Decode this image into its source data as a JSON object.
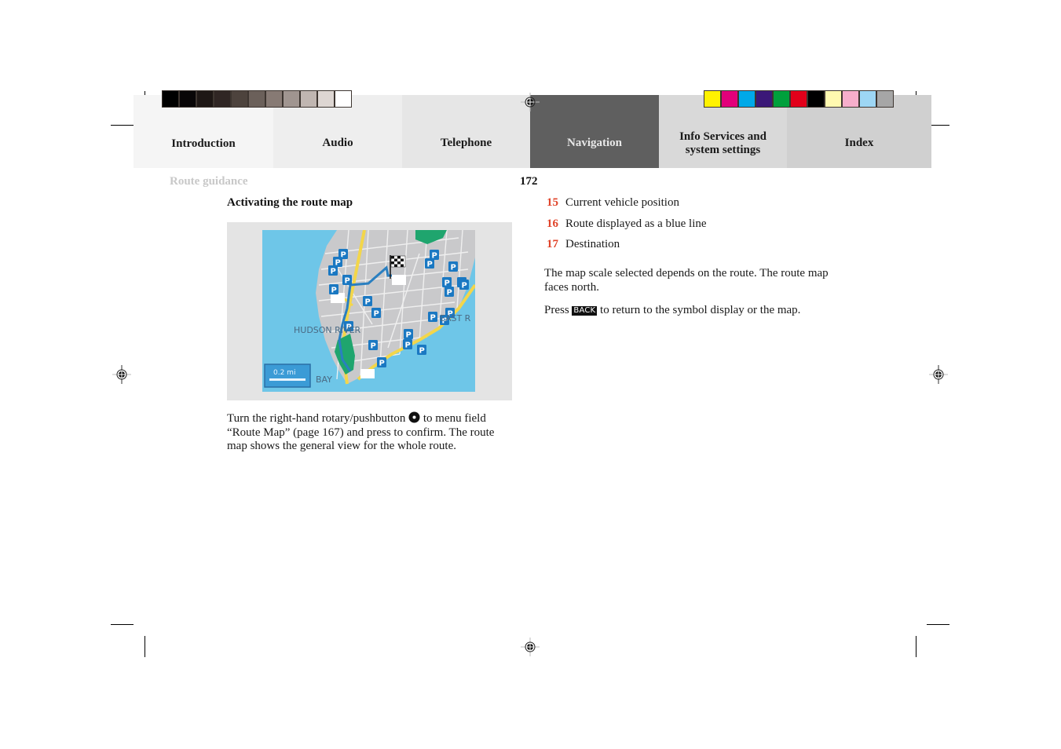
{
  "tabs": [
    {
      "label": "Introduction",
      "active": false,
      "bg": "#f5f5f5"
    },
    {
      "label": "Audio",
      "active": false,
      "bg": "#eeeeee"
    },
    {
      "label": "Telephone",
      "active": false,
      "bg": "#e6e6e6"
    },
    {
      "label": "Navigation",
      "active": true,
      "bg": "#5f5f5f"
    },
    {
      "label": "Info Services and system settings",
      "line1": "Info Services and",
      "line2": "system settings",
      "active": false,
      "bg": "#d9d9d9"
    },
    {
      "label": "Index",
      "active": false,
      "bg": "#d0d0d0"
    }
  ],
  "gray_swatches": [
    "#000000",
    "#090607",
    "#1e1715",
    "#302624",
    "#4d433d",
    "#6b605a",
    "#877a74",
    "#a09590",
    "#c0b6b1",
    "#ddd6d2",
    "#ffffff"
  ],
  "color_swatches": [
    "#fff200",
    "#e2007a",
    "#00a9e8",
    "#3b1878",
    "#00a03c",
    "#e2001a",
    "#000000",
    "#fff9b0",
    "#f6aecb",
    "#9dd6f4",
    "#a6a6a6"
  ],
  "header": {
    "section": "Route guidance",
    "page_number": "172"
  },
  "left_column": {
    "heading": "Activating the route map",
    "figure": {
      "labels": {
        "river": "HUDSON RIVER",
        "east": "EAST R",
        "bay": "BAY",
        "scale": "0.2 mi"
      }
    },
    "instruction": {
      "part1": "Turn the right-hand rotary/pushbutton",
      "icon": "rotary-pushbutton-icon",
      "part2": "to menu field “Route Map” (page 167) and press to confirm. The route map shows the general view for the whole route."
    }
  },
  "right_column": {
    "legend": [
      {
        "num": "15",
        "text": "Current vehicle position"
      },
      {
        "num": "16",
        "text": "Route displayed as a blue line"
      },
      {
        "num": "17",
        "text": "Destination"
      }
    ],
    "para1": "The map scale selected depends on the route. The route map faces north.",
    "para2_before": "Press",
    "back_key": "BACK",
    "para2_after": "to return to the symbol display or the map."
  },
  "colors": {
    "accent_number": "#e0442a",
    "route_blue": "#2a7fc0",
    "parking_blue": "#1a78c2",
    "park_green": "#1fa56e",
    "road_yellow": "#f3d64a"
  }
}
